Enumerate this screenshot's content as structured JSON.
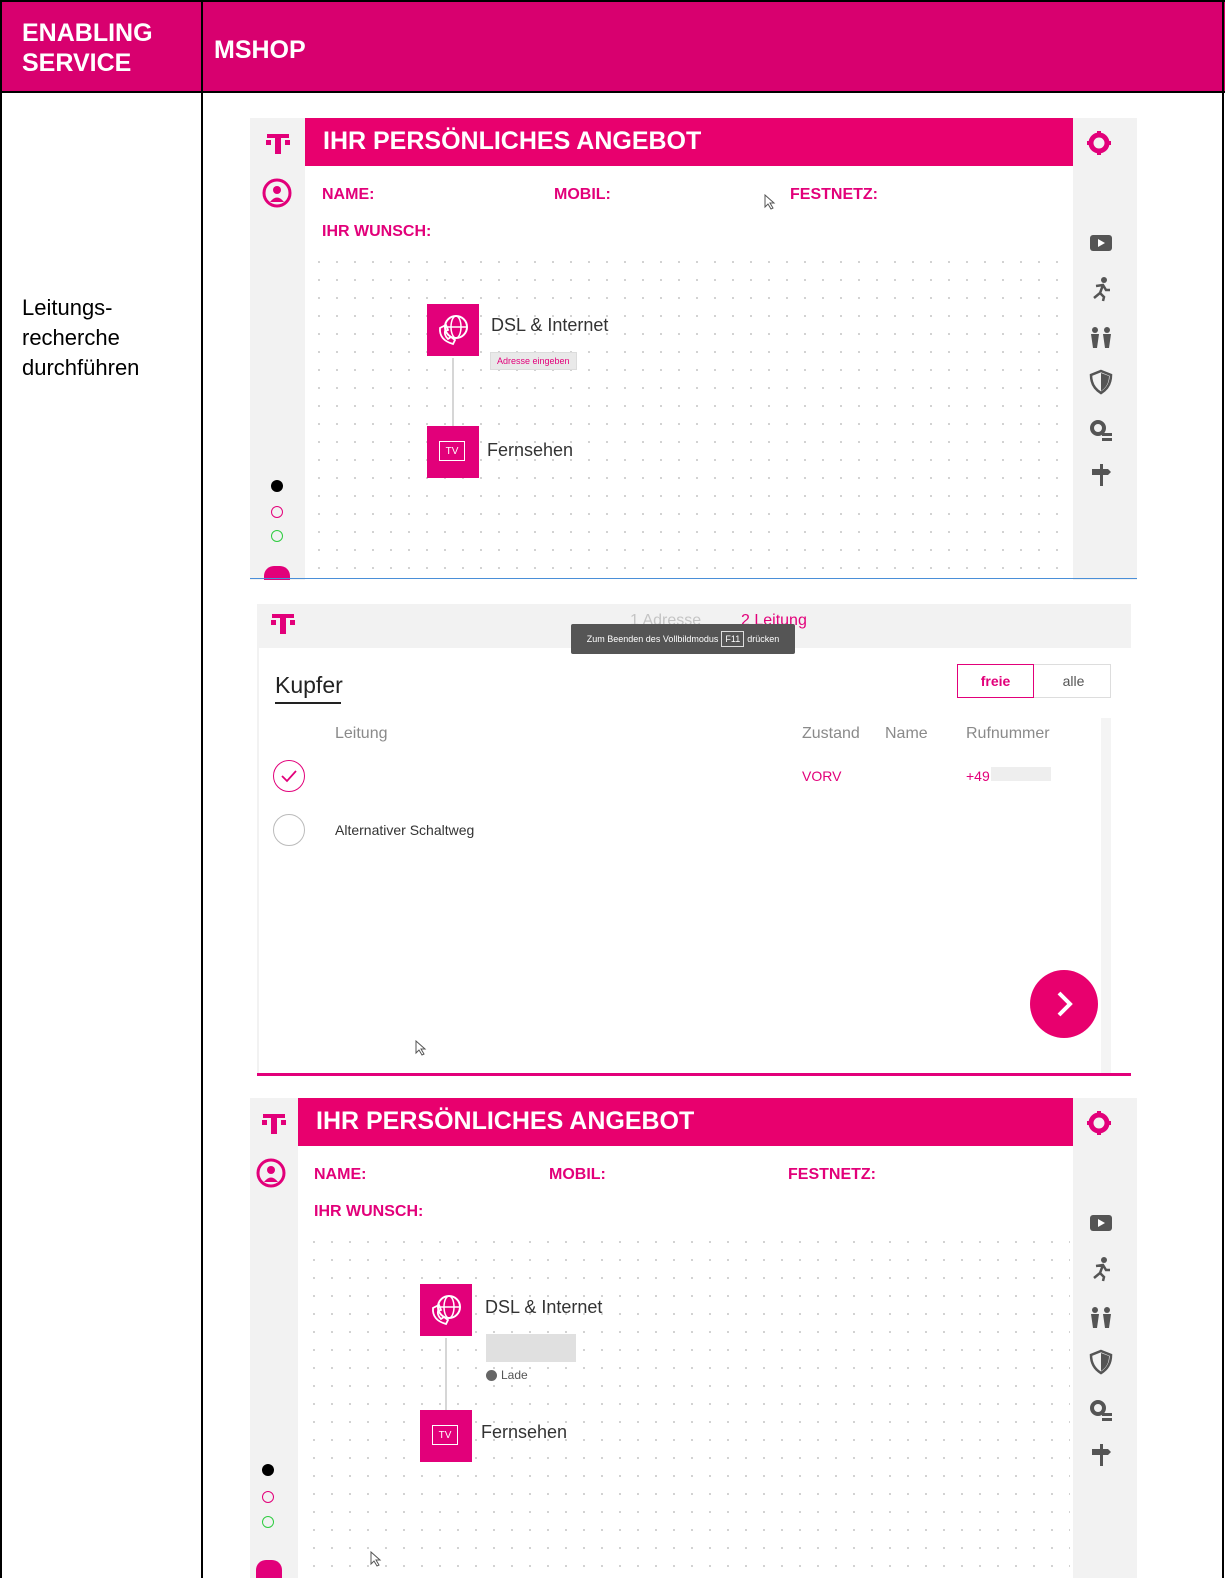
{
  "table": {
    "header_left": [
      "ENABLING",
      "SERVICE"
    ],
    "header_right": "MSHOP",
    "row_label": [
      "Leitungs-",
      "recherche",
      "durchführen"
    ]
  },
  "offer_panel": {
    "title": "IHR PERSÖNLICHES ANGEBOT",
    "name_label": "NAME:",
    "mobil_label": "MOBIL:",
    "festnetz_label": "FESTNETZ:",
    "wunsch_label": "IHR WUNSCH:",
    "dsl_label": "DSL & Internet",
    "tv_label": "Fernsehen",
    "tv_icon_text": "TV",
    "address_chip": "Adresse eingeben",
    "loading_text": "Lade"
  },
  "line_panel": {
    "step1": "1 Adresse",
    "step2": "2 Leitung",
    "toast_before": "Zum Beenden des Vollbildmodus",
    "toast_key": "F11",
    "toast_after": "drücken",
    "section_title": "Kupfer",
    "filter_free": "freie",
    "filter_all": "alle",
    "columns": {
      "leitung": "Leitung",
      "zustand": "Zustand",
      "name": "Name",
      "rufnummer": "Rufnummer"
    },
    "rows": [
      {
        "leitung": "",
        "zustand": "VORV",
        "rufnummer": "+49"
      },
      {
        "leitung": "Alternativer Schaltweg",
        "zustand": "",
        "rufnummer": ""
      }
    ]
  },
  "colors": {
    "brand": "#e2007a",
    "header": "#d8006f"
  }
}
